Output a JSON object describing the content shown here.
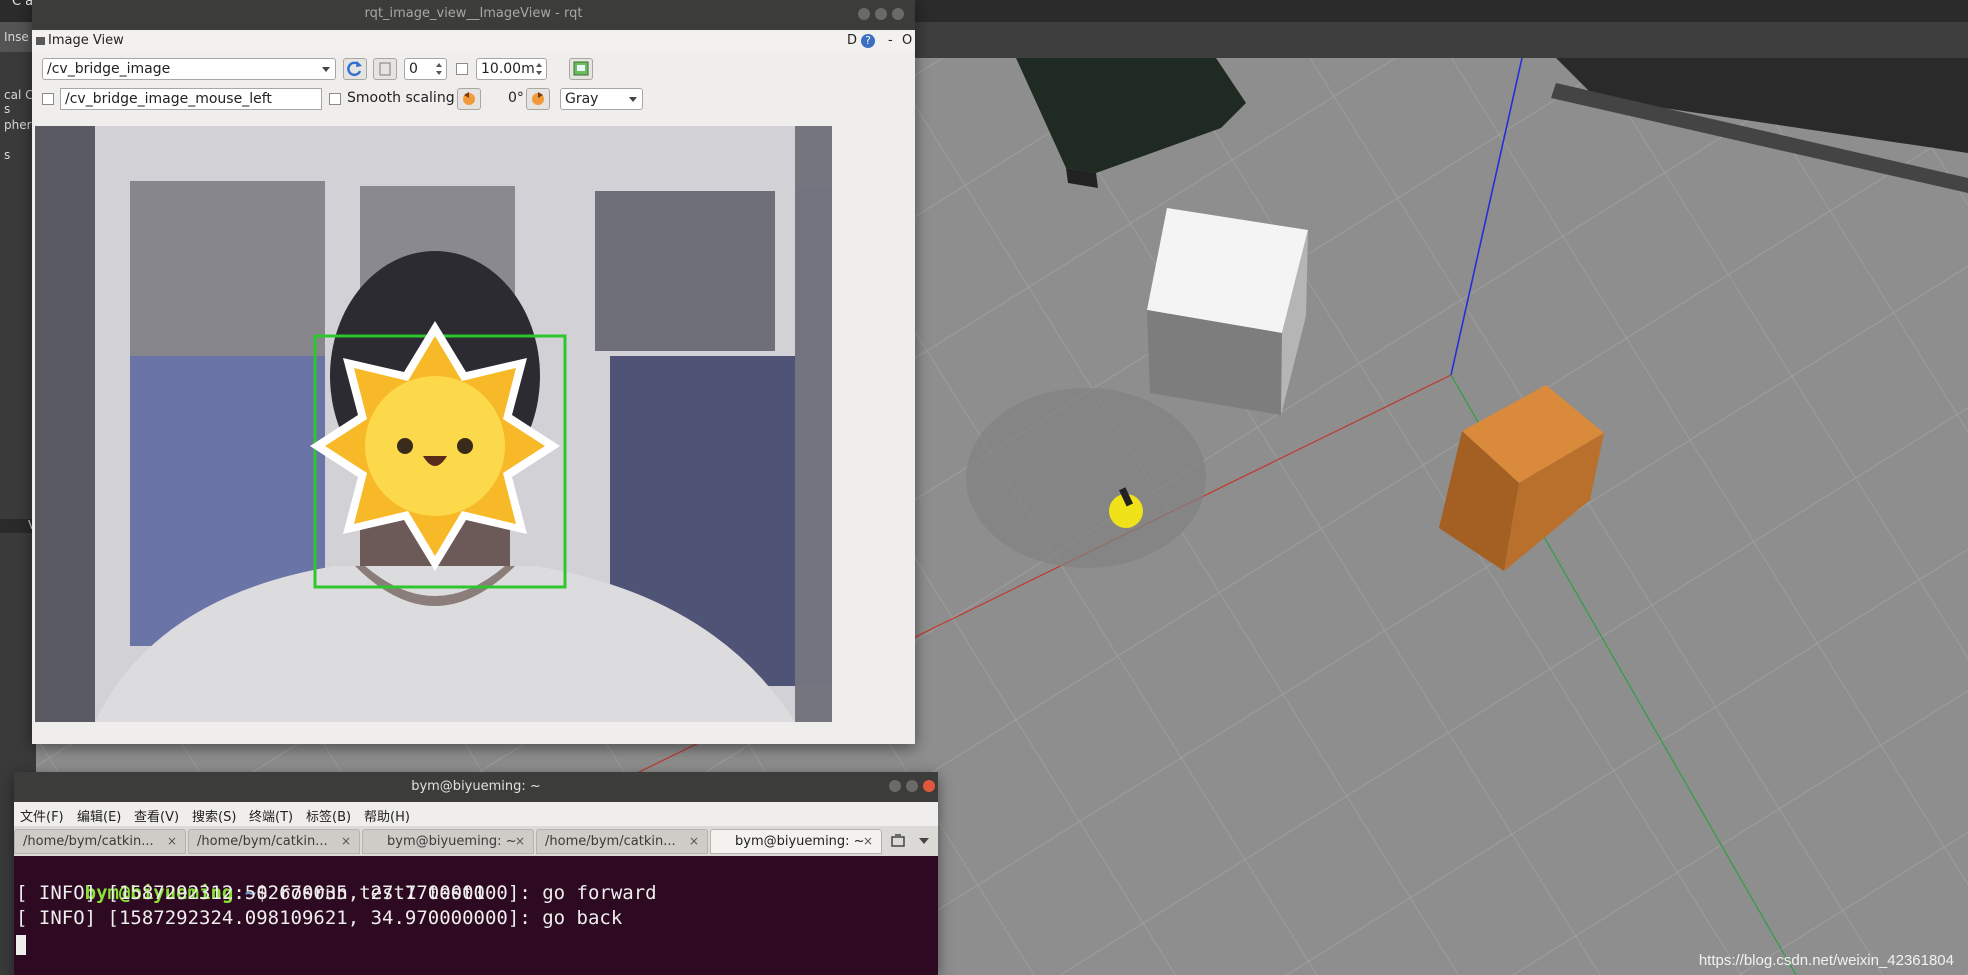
{
  "gazebo": {
    "menu_partial": "Ca",
    "insert_tab_partial": "Inse",
    "left_labels": [
      "cal Co",
      "s",
      "phere",
      "s"
    ],
    "divider_label": "V"
  },
  "watermark": "https://blog.csdn.net/weixin_42361804",
  "rqt": {
    "window_title": "rqt_image_view__ImageView - rqt",
    "plugin_title": "Image View",
    "header_controls": [
      "D",
      "?",
      "-",
      "O"
    ],
    "topic": "/cv_bridge_image",
    "spin_value": "0",
    "max_value": "10.00m",
    "mouse_topic": "/cv_bridge_image_mouse_left",
    "smooth_scaling_label": "Smooth scaling",
    "rotation": "0°",
    "color_scheme": "Gray",
    "colors": {
      "detection_box": "#2fc52f",
      "sun_fill": "#f8b928"
    }
  },
  "terminal": {
    "window_title": "bym@biyueming: ~",
    "menu": [
      "文件(F)",
      "编辑(E)",
      "查看(V)",
      "搜索(S)",
      "终端(T)",
      "标签(B)",
      "帮助(H)"
    ],
    "tabs": [
      {
        "label": "/home/bym/catkin...",
        "close": "×"
      },
      {
        "label": "/home/bym/catkin...",
        "close": "×"
      },
      {
        "label": "bym@biyueming: ~",
        "close": "×"
      },
      {
        "label": "/home/bym/catkin...",
        "close": "×"
      },
      {
        "label": "bym@biyueming: ~",
        "close": "×"
      }
    ],
    "prompt_user": "bym@biyueming",
    "prompt_sep": ":",
    "prompt_path": "~",
    "prompt_end": "$ ",
    "command": "rosrun test1 test1",
    "lines": [
      "[ INFO] [1587292312.502670035, 27.770000000]: go forward",
      "[ INFO] [1587292324.098109621, 34.970000000]: go back"
    ],
    "colors": {
      "background": "#2d0922",
      "prompt_user": "#8ae234",
      "prompt_path": "#729fcf"
    }
  }
}
